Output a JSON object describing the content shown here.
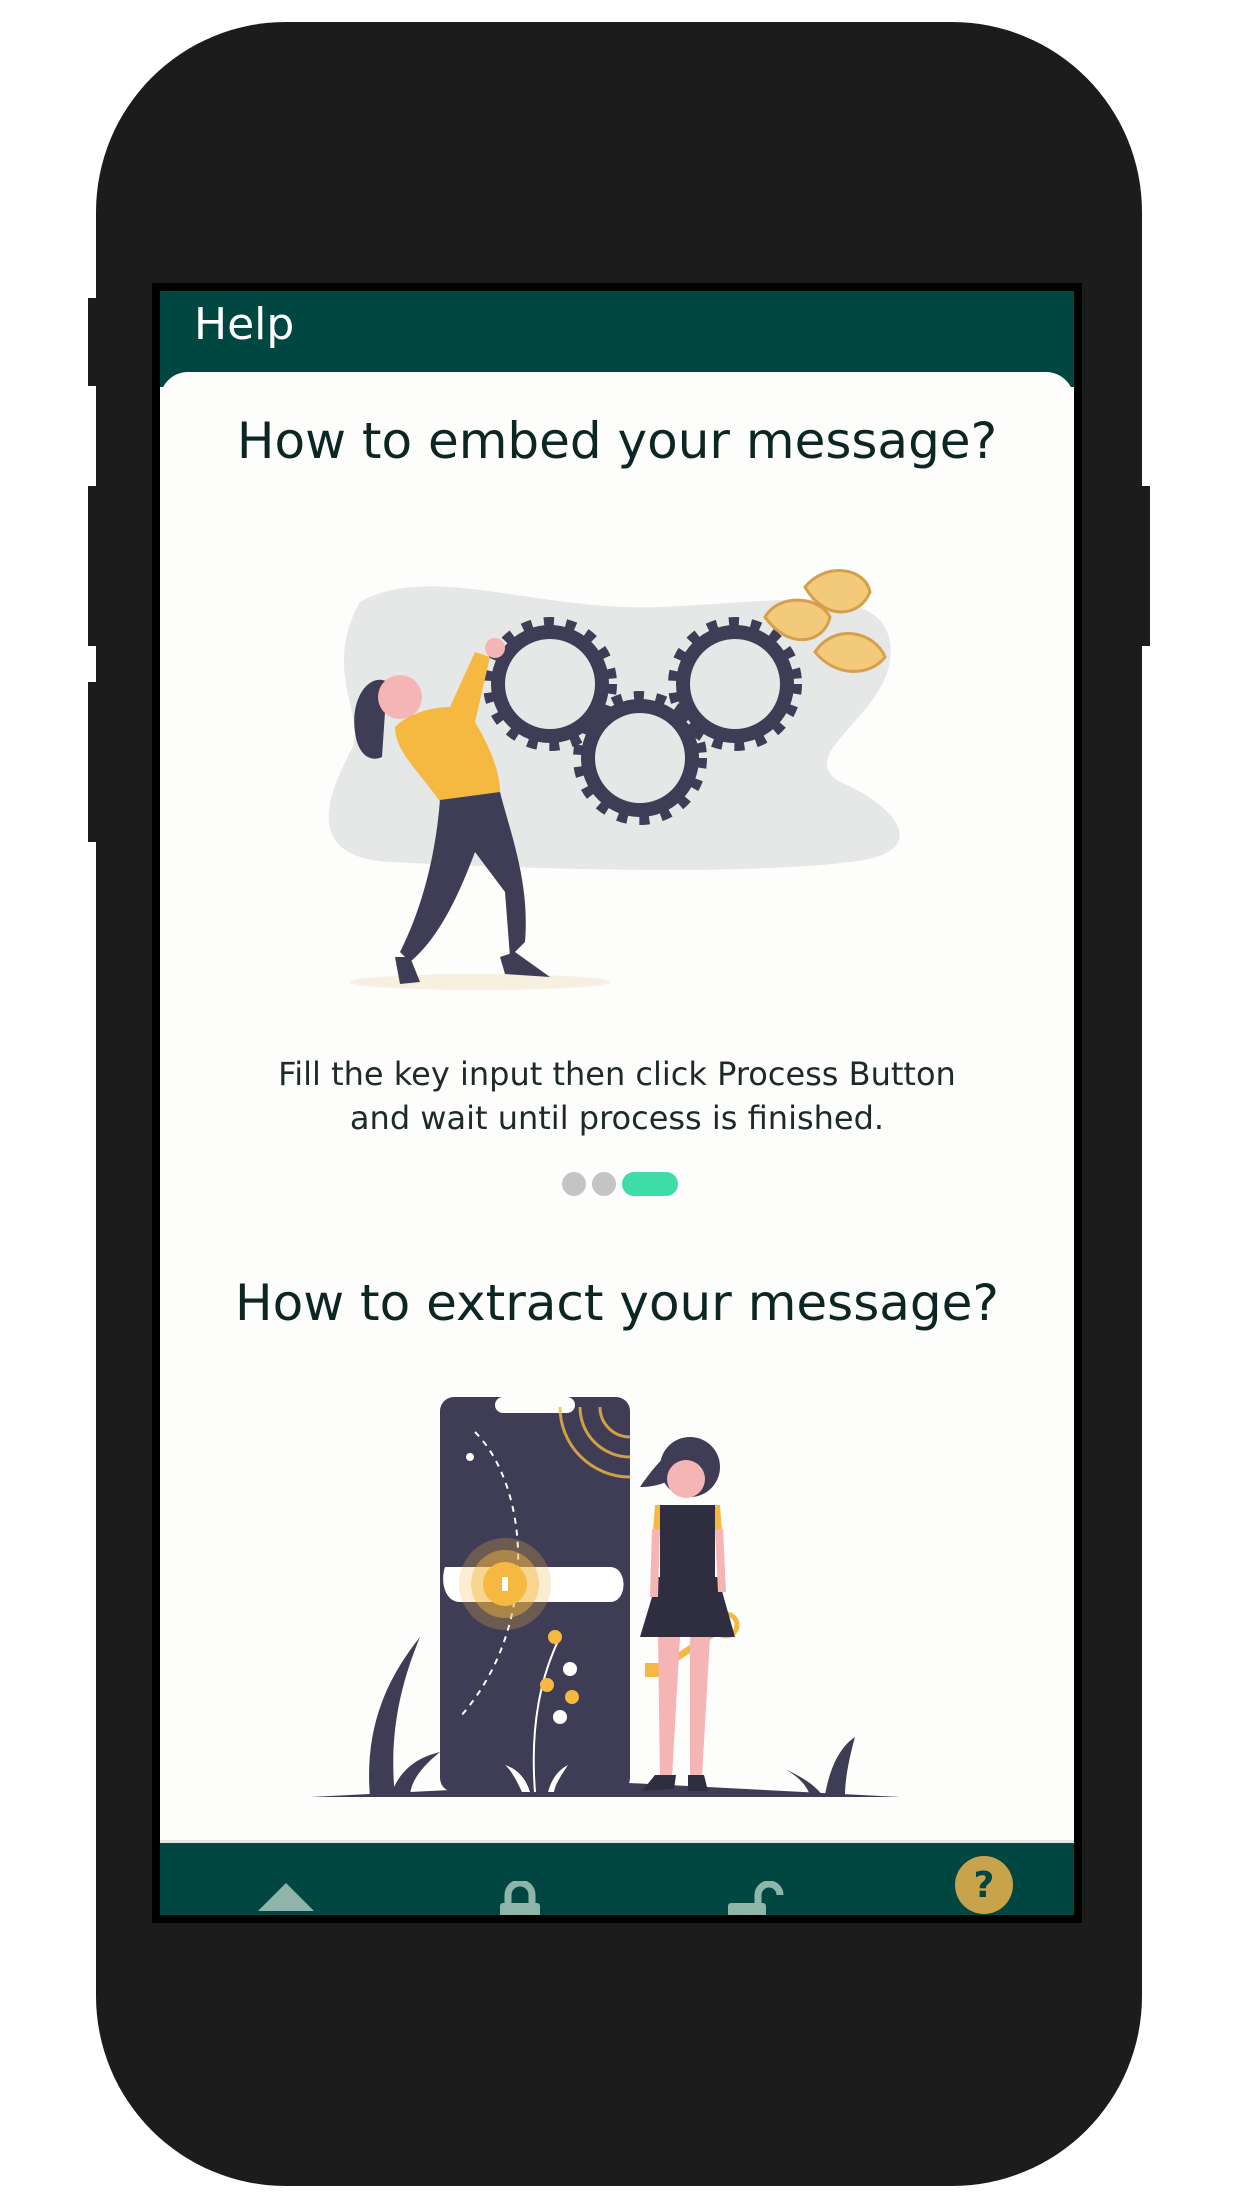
{
  "app": {
    "title": "Help"
  },
  "help_sections": [
    {
      "heading": "How to embed your message?",
      "illustration": "woman-arranging-gears-illustration",
      "description_line1": "Fill the key input then click Process Button",
      "description_line2": "and wait until process is finished."
    },
    {
      "heading": "How to extract your message?",
      "illustration": "woman-unlocking-phone-with-key-illustration"
    }
  ],
  "carousel": {
    "page_count": 3,
    "active_index": 2
  },
  "bottom_nav": {
    "items": [
      {
        "name": "home",
        "icon": "home-icon",
        "active": false
      },
      {
        "name": "embed",
        "icon": "lock-icon",
        "active": false
      },
      {
        "name": "extract",
        "icon": "unlock-icon",
        "active": false
      },
      {
        "name": "help",
        "icon": "help-icon",
        "active": true
      }
    ]
  },
  "colors": {
    "primary": "#004641",
    "accent": "#3fdcaa",
    "active_icon": "#c9a24c",
    "inactive_icon": "#8fb5ab",
    "illustration_yellow": "#f5b942",
    "illustration_dark": "#3f3d56"
  }
}
